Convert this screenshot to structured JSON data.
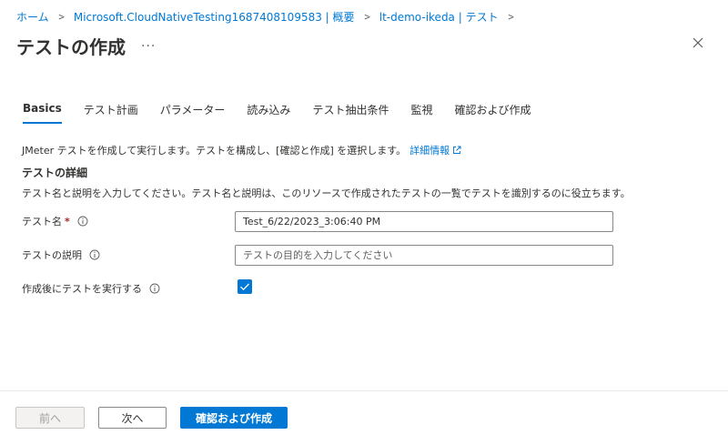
{
  "breadcrumb": {
    "items": [
      "ホーム",
      "Microsoft.CloudNativeTesting1687408109583 | 概要",
      "lt-demo-ikeda | テスト"
    ],
    "separator": ">"
  },
  "header": {
    "title": "テストの作成",
    "more_label": "...",
    "close_icon": "close-icon"
  },
  "tabs": [
    {
      "label": "Basics",
      "active": true
    },
    {
      "label": "テスト計画",
      "active": false
    },
    {
      "label": "パラメーター",
      "active": false
    },
    {
      "label": "読み込み",
      "active": false
    },
    {
      "label": "テスト抽出条件",
      "active": false
    },
    {
      "label": "監視",
      "active": false
    },
    {
      "label": "確認および作成",
      "active": false
    }
  ],
  "intro": {
    "text": "JMeter テストを作成して実行します。テストを構成し、[確認と作成] を選択します。",
    "link_label": "詳細情報"
  },
  "section": {
    "heading": "テストの詳細",
    "description": "テスト名と説明を入力してください。テスト名と説明は、このリソースで作成されたテストの一覧でテストを識別するのに役立ちます。"
  },
  "form": {
    "test_name": {
      "label": "テスト名",
      "required_mark": "*",
      "value": "Test_6/22/2023_3:06:40 PM"
    },
    "test_description": {
      "label": "テストの説明",
      "value": "",
      "placeholder": "テストの目的を入力してください"
    },
    "run_after_create": {
      "label": "作成後にテストを実行する",
      "checked": true
    }
  },
  "footer": {
    "prev_label": "前へ",
    "next_label": "次へ",
    "create_label": "確認および作成"
  },
  "colors": {
    "accent": "#0078d4",
    "required": "#a4262c",
    "text": "#323130"
  }
}
